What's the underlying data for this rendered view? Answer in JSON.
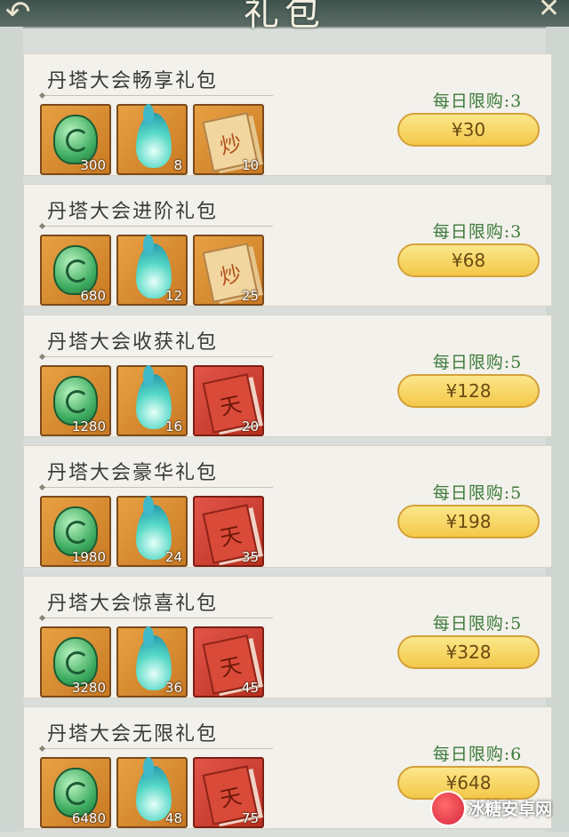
{
  "header": {
    "title": "礼包",
    "back_icon": "back-arrow-icon",
    "close_icon": "close-icon"
  },
  "packs": [
    {
      "name": "丹塔大会畅享礼包",
      "limit": "每日限购:3",
      "price": "¥30",
      "items": [
        {
          "icon": "jade-icon",
          "qty": "300",
          "bg": "gold"
        },
        {
          "icon": "spirit-flame-icon",
          "qty": "8",
          "bg": "gold"
        },
        {
          "icon": "scroll-icon",
          "qty": "10",
          "bg": "gold",
          "glyph": "炒"
        }
      ]
    },
    {
      "name": "丹塔大会进阶礼包",
      "limit": "每日限购:3",
      "price": "¥68",
      "items": [
        {
          "icon": "jade-icon",
          "qty": "680",
          "bg": "gold"
        },
        {
          "icon": "spirit-flame-icon",
          "qty": "12",
          "bg": "gold"
        },
        {
          "icon": "scroll-icon",
          "qty": "25",
          "bg": "gold",
          "glyph": "炒"
        }
      ]
    },
    {
      "name": "丹塔大会收获礼包",
      "limit": "每日限购:5",
      "price": "¥128",
      "items": [
        {
          "icon": "jade-icon",
          "qty": "1280",
          "bg": "gold"
        },
        {
          "icon": "spirit-flame-icon",
          "qty": "16",
          "bg": "gold"
        },
        {
          "icon": "scroll-icon",
          "qty": "20",
          "bg": "red",
          "glyph": "天"
        }
      ]
    },
    {
      "name": "丹塔大会豪华礼包",
      "limit": "每日限购:5",
      "price": "¥198",
      "items": [
        {
          "icon": "jade-icon",
          "qty": "1980",
          "bg": "gold"
        },
        {
          "icon": "spirit-flame-icon",
          "qty": "24",
          "bg": "gold"
        },
        {
          "icon": "scroll-icon",
          "qty": "35",
          "bg": "red",
          "glyph": "天"
        }
      ]
    },
    {
      "name": "丹塔大会惊喜礼包",
      "limit": "每日限购:5",
      "price": "¥328",
      "items": [
        {
          "icon": "jade-icon",
          "qty": "3280",
          "bg": "gold"
        },
        {
          "icon": "spirit-flame-icon",
          "qty": "36",
          "bg": "gold"
        },
        {
          "icon": "scroll-icon",
          "qty": "45",
          "bg": "red",
          "glyph": "天"
        }
      ]
    },
    {
      "name": "丹塔大会无限礼包",
      "limit": "每日限购:6",
      "price": "¥648",
      "items": [
        {
          "icon": "jade-icon",
          "qty": "6480",
          "bg": "gold"
        },
        {
          "icon": "spirit-flame-icon",
          "qty": "48",
          "bg": "gold"
        },
        {
          "icon": "scroll-icon",
          "qty": "75",
          "bg": "red",
          "glyph": "天"
        }
      ]
    }
  ],
  "watermark": {
    "text": "冰糖安卓网"
  },
  "colors": {
    "limit_text": "#3c7a3a",
    "buy_button": "#f3c84a",
    "panel": "#f3f1ec"
  }
}
